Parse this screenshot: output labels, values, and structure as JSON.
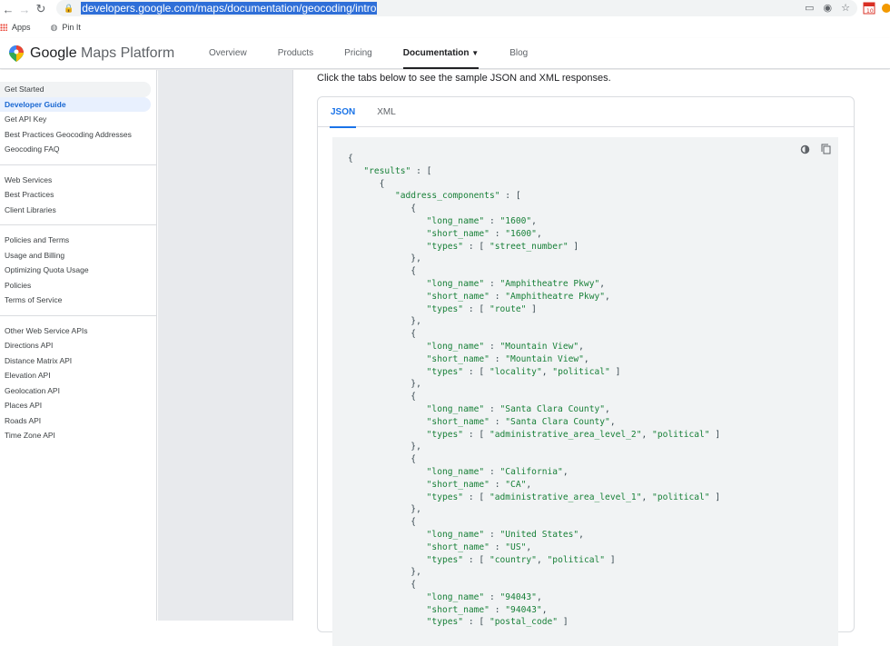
{
  "browser": {
    "url": "developers.google.com/maps/documentation/geocoding/intro",
    "bookmarks": [
      "Apps",
      "Pin It"
    ]
  },
  "header": {
    "logo_google": "Google",
    "logo_rest": "Maps Platform",
    "nav": [
      "Overview",
      "Products",
      "Pricing",
      "Documentation",
      "Blog"
    ],
    "nav_active": "Documentation"
  },
  "sidebar": {
    "groups": [
      [
        "Get Started",
        "Developer Guide",
        "Get API Key",
        "Best Practices Geocoding Addresses",
        "Geocoding FAQ"
      ],
      [
        "Web Services",
        "Best Practices",
        "Client Libraries"
      ],
      [
        "Policies and Terms",
        "Usage and Billing",
        "Optimizing Quota Usage",
        "Policies",
        "Terms of Service"
      ],
      [
        "Other Web Service APIs",
        "Directions API",
        "Distance Matrix API",
        "Elevation API",
        "Geolocation API",
        "Places API",
        "Roads API",
        "Time Zone API"
      ]
    ],
    "active": "Developer Guide",
    "hover": "Get Started"
  },
  "main": {
    "intro": "Click the tabs below to see the sample JSON and XML responses.",
    "tabs": [
      "JSON",
      "XML"
    ],
    "active_tab": "JSON"
  },
  "code": {
    "components": [
      {
        "long_name": "1600",
        "short_name": "1600",
        "types": [
          "street_number"
        ]
      },
      {
        "long_name": "Amphitheatre Pkwy",
        "short_name": "Amphitheatre Pkwy",
        "types": [
          "route"
        ]
      },
      {
        "long_name": "Mountain View",
        "short_name": "Mountain View",
        "types": [
          "locality",
          "political"
        ]
      },
      {
        "long_name": "Santa Clara County",
        "short_name": "Santa Clara County",
        "types": [
          "administrative_area_level_2",
          "political"
        ]
      },
      {
        "long_name": "California",
        "short_name": "CA",
        "types": [
          "administrative_area_level_1",
          "political"
        ]
      },
      {
        "long_name": "United States",
        "short_name": "US",
        "types": [
          "country",
          "political"
        ]
      },
      {
        "long_name": "94043",
        "short_name": "94043",
        "types": [
          "postal_code"
        ]
      }
    ]
  }
}
